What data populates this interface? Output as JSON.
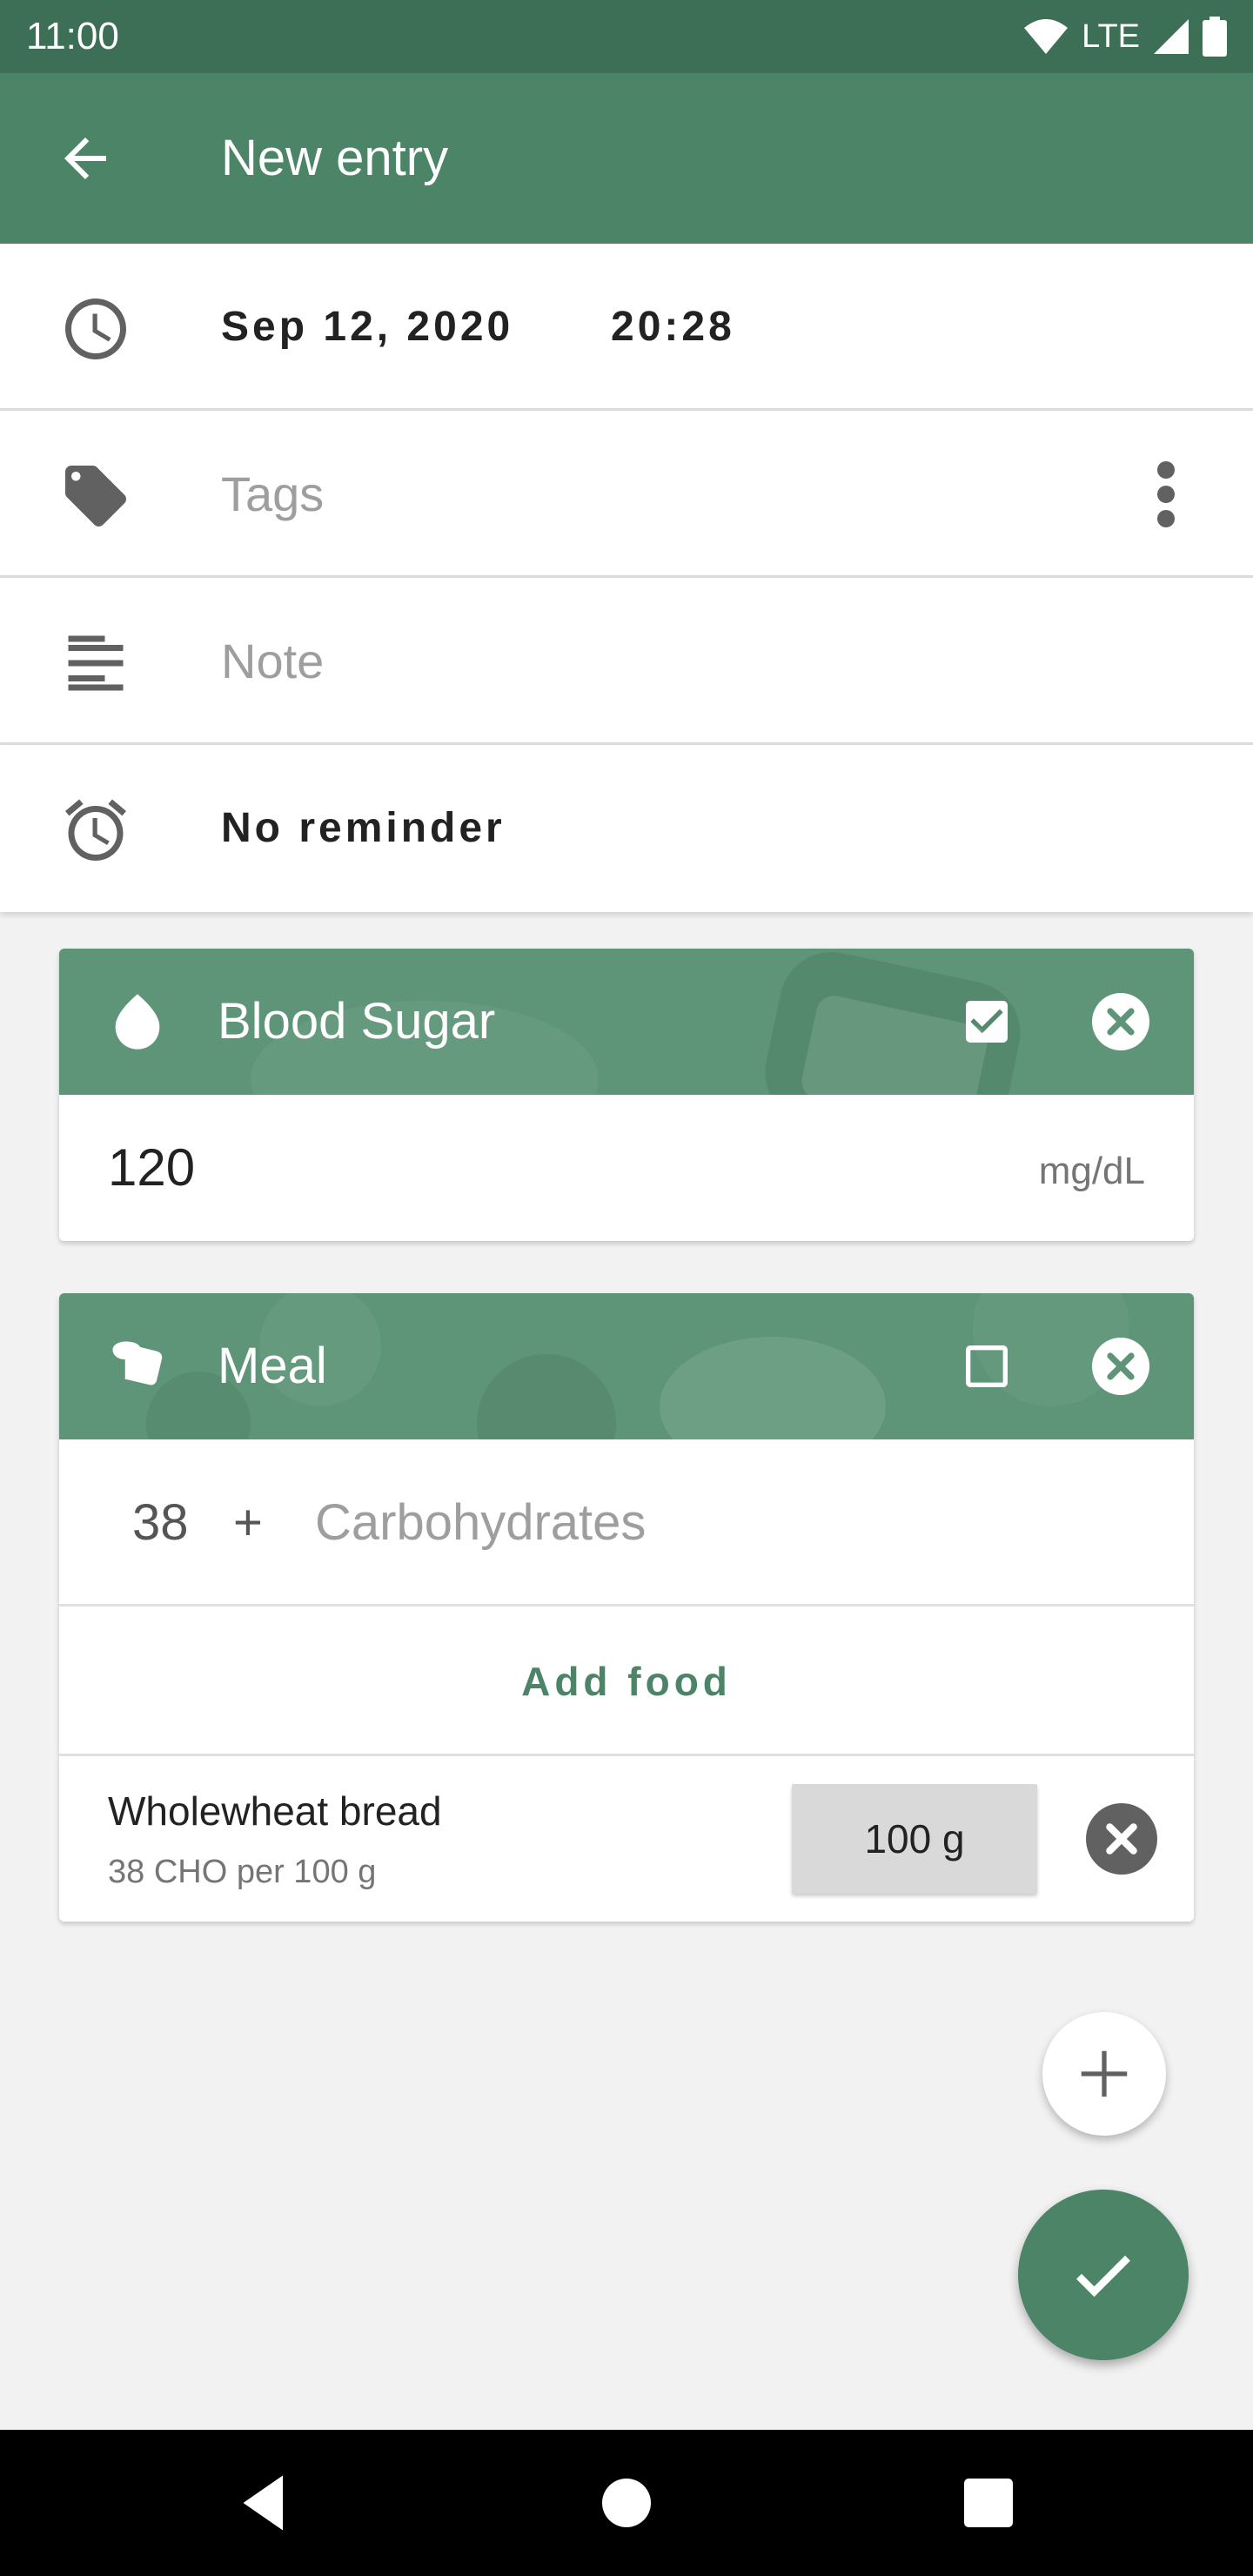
{
  "status_bar": {
    "time": "11:00",
    "network": "LTE"
  },
  "app_bar": {
    "title": "New entry",
    "back_icon": "arrow-back-icon"
  },
  "fields": {
    "date": "Sep 12, 2020",
    "time": "20:28",
    "tags_placeholder": "Tags",
    "note_placeholder": "Note",
    "reminder": "No reminder"
  },
  "blood_sugar_card": {
    "title": "Blood Sugar",
    "value": "120",
    "unit": "mg/dL",
    "checked": true
  },
  "meal_card": {
    "title": "Meal",
    "checked": false,
    "carb_value": "38",
    "plus": "+",
    "carb_placeholder": "Carbohydrates",
    "add_food_label": "Add food",
    "foods": [
      {
        "name": "Wholewheat bread",
        "detail": "38 CHO per 100 g",
        "amount": "100 g"
      }
    ]
  },
  "colors": {
    "status_bar": "#3d6f56",
    "app_bar": "#4b8467",
    "card_header": "#5e9478",
    "accent": "#4b8467"
  }
}
